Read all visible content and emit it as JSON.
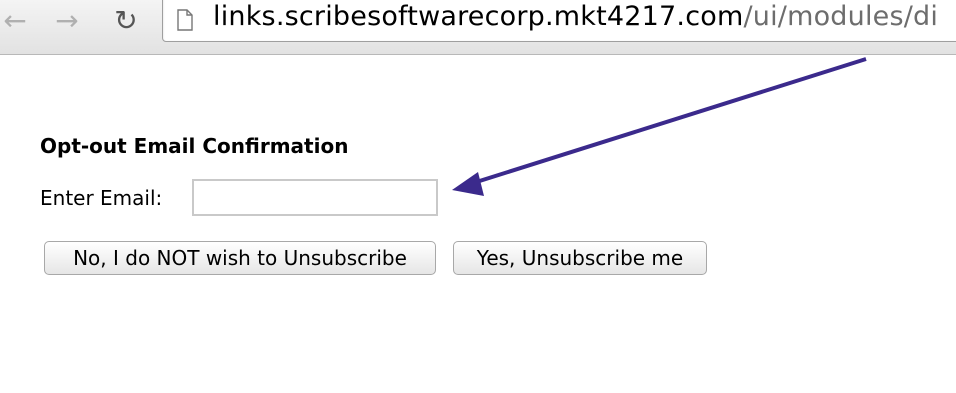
{
  "browser": {
    "icons": {
      "back": "back-arrow-icon",
      "forward": "forward-arrow-icon",
      "reload": "reload-icon",
      "page": "page-icon"
    },
    "back_glyph": "←",
    "forward_glyph": "→",
    "reload_glyph": "↻",
    "url_host": "links.scribesoftwarecorp.mkt4217.com",
    "url_path": "/ui/modules/di"
  },
  "form": {
    "title": "Opt-out Email Confirmation",
    "email_label": "Enter Email:",
    "email_value": "",
    "email_placeholder": "",
    "no_button": "No, I do NOT wish to Unsubscribe",
    "yes_button": "Yes, Unsubscribe me"
  },
  "annotation": {
    "arrow_color": "#3b2a8c"
  }
}
